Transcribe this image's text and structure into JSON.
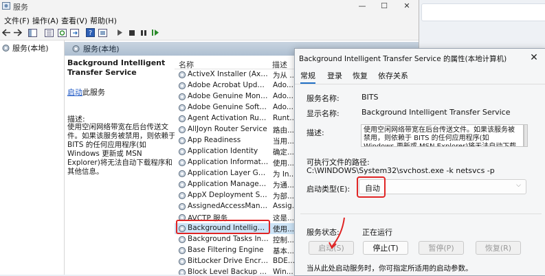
{
  "window": {
    "title": "服务",
    "controls": {
      "minimize": "—",
      "maximize": "☐",
      "close": "✕"
    }
  },
  "menu": [
    "文件(F)",
    "操作(A)",
    "查看(V)",
    "帮助(H)"
  ],
  "tree": {
    "item": "服务(本地)"
  },
  "panel": {
    "header": "服务(本地)",
    "service_title": "Background Intelligent Transfer Service",
    "start_link": "启动",
    "start_suffix": "此服务",
    "desc_label": "描述:",
    "desc_text": "使用空闲网络带宽在后台传送文件。如果该服务被禁用，则依赖于 BITS 的任何应用程序(如 Windows 更新或 MSN Explorer)将无法自动下载程序和其他信息。"
  },
  "list": {
    "columns": {
      "name": "名称",
      "desc": "描述"
    },
    "rows": [
      {
        "name": "ActiveX Installer (AxInstSV)",
        "desc": "为从 ..."
      },
      {
        "name": "Adobe Acrobat Update Serv...",
        "desc": "Ado..."
      },
      {
        "name": "Adobe Genuine Monitor Se...",
        "desc": "Ado..."
      },
      {
        "name": "Adobe Genuine Software I...",
        "desc": "Ado..."
      },
      {
        "name": "Agent Activation Runtime_...",
        "desc": "Runt..."
      },
      {
        "name": "AllJoyn Router Service",
        "desc": "路由..."
      },
      {
        "name": "App Readiness",
        "desc": "当用..."
      },
      {
        "name": "Application Identity",
        "desc": "确定..."
      },
      {
        "name": "Application Information",
        "desc": "使用..."
      },
      {
        "name": "Application Layer Gateway ...",
        "desc": "为 In..."
      },
      {
        "name": "Application Management",
        "desc": "为通..."
      },
      {
        "name": "AppX Deployment Service (...",
        "desc": "为部..."
      },
      {
        "name": "AssignedAccessManager ...",
        "desc": "Assig..."
      },
      {
        "name": "AVCTP 服务",
        "desc": "这是..."
      },
      {
        "name": "Background Intelligent Tra...",
        "desc": "使用..."
      },
      {
        "name": "Background Tasks Infrastru...",
        "desc": "控制..."
      },
      {
        "name": "Base Filtering Engine",
        "desc": "基本..."
      },
      {
        "name": "BitLocker Drive Encryption ...",
        "desc": "BDE..."
      },
      {
        "name": "Block Level Backup Engine ...",
        "desc": "Win..."
      }
    ]
  },
  "dialog": {
    "title": "Background Intelligent Transfer Service 的属性(本地计算机)",
    "close": "✕",
    "tabs": [
      "常规",
      "登录",
      "恢复",
      "依存关系"
    ],
    "service_name_label": "服务名称:",
    "service_name": "BITS",
    "display_name_label": "显示名称:",
    "display_name": "Background Intelligent Transfer Service",
    "desc_label": "描述:",
    "desc_text": "使用空闲网络带宽在后台传送文件。如果该服务被禁用，则依赖于 BITS 的任何应用程序(如 Windows 更新或 MSN Explorer)将无法自动下载程序和其他信息。",
    "path_label": "可执行文件的路径:",
    "path": "C:\\WINDOWS\\System32\\svchost.exe -k netsvcs -p",
    "startup_label": "启动类型(E):",
    "startup_value": "自动",
    "status_label": "服务状态:",
    "status_value": "正在运行",
    "buttons": {
      "start": "启动(S)",
      "stop": "停止(T)",
      "pause": "暂停(P)",
      "resume": "恢复(R)"
    },
    "note": "当从此处启动服务时，你可指定所适用的启动参数。"
  },
  "colors": {
    "highlight": "#e02424",
    "accent": "#1f6fc5",
    "link": "#1a55c4"
  }
}
